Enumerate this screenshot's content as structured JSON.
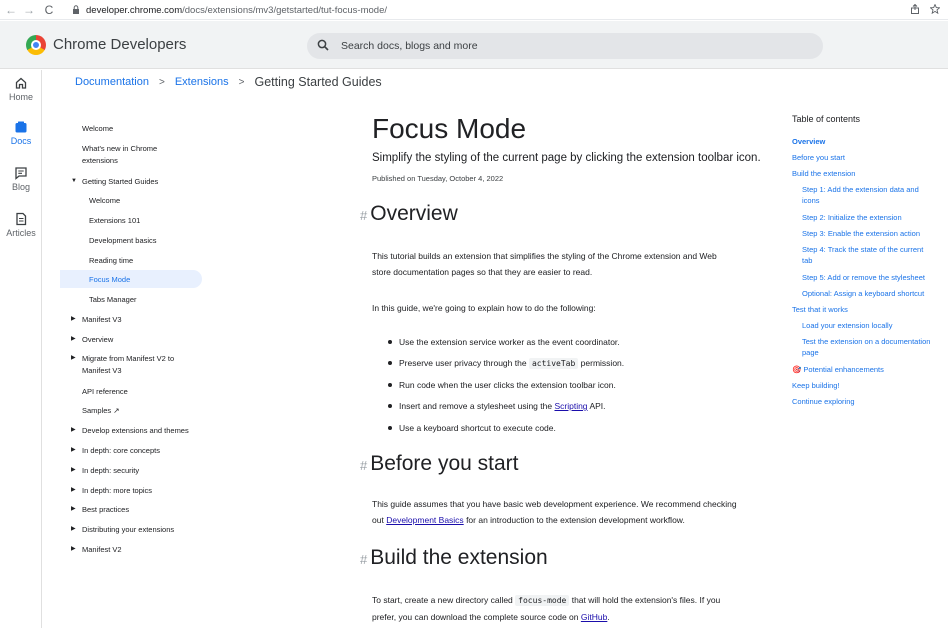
{
  "browser": {
    "back": "←",
    "forward": "→",
    "reload": "C",
    "url_host": "developer.chrome.com",
    "url_path": "/docs/extensions/mv3/getstarted/tut-focus-mode/",
    "share_icon": "share-icon",
    "bookmark_icon": "star-icon"
  },
  "header": {
    "site_title": "Chrome Developers",
    "search_placeholder": "Search docs, blogs and more"
  },
  "rail": {
    "items": [
      {
        "label": "Home",
        "icon": "home-icon"
      },
      {
        "label": "Docs",
        "icon": "docs-icon"
      },
      {
        "label": "Blog",
        "icon": "blog-icon"
      },
      {
        "label": "Articles",
        "icon": "articles-icon"
      }
    ]
  },
  "breadcrumb": {
    "items": [
      "Documentation",
      "Extensions",
      "Getting Started Guides"
    ],
    "separator": ">"
  },
  "leftnav": {
    "items": [
      {
        "label": "Welcome"
      },
      {
        "label": "What's new in Chrome"
      },
      {
        "label": "extensions"
      },
      {
        "label": "Getting Started Guides"
      },
      {
        "label": "Welcome"
      },
      {
        "label": "Extensions 101"
      },
      {
        "label": "Development basics"
      },
      {
        "label": "Reading time"
      },
      {
        "label": "Focus Mode"
      },
      {
        "label": "Tabs Manager"
      },
      {
        "label": "Manifest V3"
      },
      {
        "label": "Overview"
      },
      {
        "label": "Migrate from Manifest V2 to"
      },
      {
        "label": "Manifest V3"
      },
      {
        "label": "API reference"
      },
      {
        "label": "Samples ↗"
      },
      {
        "label": "Develop extensions and themes"
      },
      {
        "label": "In depth: core concepts"
      },
      {
        "label": "In depth: security"
      },
      {
        "label": "In depth: more topics"
      },
      {
        "label": "Best practices"
      },
      {
        "label": "Distributing your extensions"
      },
      {
        "label": "Manifest V2"
      }
    ]
  },
  "article": {
    "title": "Focus Mode",
    "subtitle": "Simplify the styling of the current page by clicking the extension toolbar icon.",
    "published": "Published on Tuesday, October 4, 2022",
    "hash": "#",
    "overview_heading": "Overview",
    "overview_p1_line1": "This tutorial builds an extension that simplifies the styling of the Chrome extension and Web",
    "overview_p1_line2": "store documentation pages so that they are easier to read.",
    "overview_p2": "In this guide, we're going to explain how to do the following:",
    "bullet1": "Use the extension service worker as the event coordinator.",
    "bullet2_pre": "Preserve user privacy through the",
    "bullet2_code": "activeTab",
    "bullet2_post": "permission.",
    "bullet3": "Run code when the user clicks the extension toolbar icon.",
    "bullet4_pre": "Insert and remove a stylesheet using the",
    "bullet4_link": "Scripting",
    "bullet4_post": "API.",
    "bullet5": "Use a keyboard shortcut to execute code.",
    "before_heading": "Before you start",
    "before_line1": "This guide assumes that you have basic web development experience. We recommend checking",
    "before_line2_pre": "out",
    "before_link": "Development Basics",
    "before_line2_post": "for an introduction to the extension development workflow.",
    "build_heading": "Build the extension",
    "build_line1_pre": "To start, create a new directory called",
    "build_code": "focus-mode",
    "build_line1_post": "that will hold the extension's files. If you",
    "build_line2_pre": "prefer, you can download the complete source code on",
    "build_link": "GitHub",
    "build_line2_post": "."
  },
  "toc": {
    "title": "Table of contents",
    "items": [
      {
        "label": "Overview"
      },
      {
        "label": "Before you start"
      },
      {
        "label": "Build the extension"
      },
      {
        "label": "Step 1: Add the extension data and"
      },
      {
        "label": "icons"
      },
      {
        "label": "Step 2: Initialize the extension"
      },
      {
        "label": "Step 3: Enable the extension action"
      },
      {
        "label": "Step 4: Track the state of the current"
      },
      {
        "label": "tab"
      },
      {
        "label": "Step 5: Add or remove the stylesheet"
      },
      {
        "label": "Optional: Assign a keyboard shortcut"
      },
      {
        "label": "Test that it works"
      },
      {
        "label": "Load your extension locally"
      },
      {
        "label": "Test the extension on a documentation"
      },
      {
        "label": "page"
      },
      {
        "label": "🎯 Potential enhancements"
      },
      {
        "label": "Keep building!"
      },
      {
        "label": "Continue exploring"
      }
    ]
  },
  "colors": {
    "link_blue": "#1a73e8",
    "active_bg": "#e8f0fe",
    "header_bg": "#f1f3f4"
  }
}
